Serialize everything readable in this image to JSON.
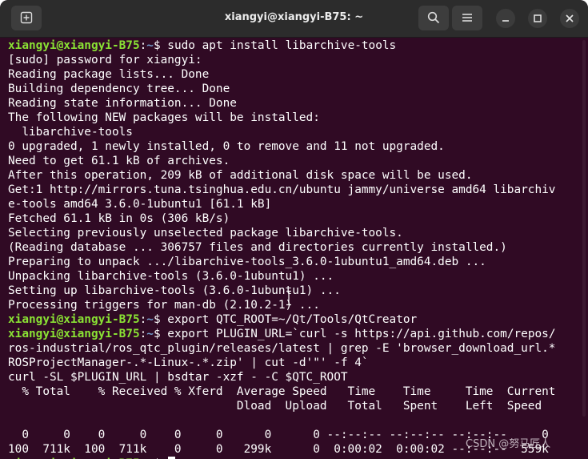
{
  "window": {
    "title": "xiangyi@xiangyi-B75: ~"
  },
  "toolbar": {
    "new_tab_icon": "new-tab-icon",
    "search_icon": "search-icon",
    "menu_icon": "hamburger-menu-icon",
    "minimize_icon": "minimize-icon",
    "maximize_icon": "maximize-icon",
    "close_icon": "close-icon"
  },
  "colors": {
    "terminal_bg": "#300a24",
    "prompt_user": "#8ae234",
    "prompt_path": "#729fcf",
    "text": "#ffffff"
  },
  "prompt": {
    "user_host": "xiangyi@xiangyi-B75",
    "colon": ":",
    "path": "~",
    "dollar": "$"
  },
  "terminal": {
    "lines": [
      {
        "type": "prompt",
        "cmd": " sudo apt install libarchive-tools"
      },
      {
        "type": "text",
        "text": "[sudo] password for xiangyi:"
      },
      {
        "type": "text",
        "text": "Reading package lists... Done"
      },
      {
        "type": "text",
        "text": "Building dependency tree... Done"
      },
      {
        "type": "text",
        "text": "Reading state information... Done"
      },
      {
        "type": "text",
        "text": "The following NEW packages will be installed:"
      },
      {
        "type": "text",
        "text": "  libarchive-tools"
      },
      {
        "type": "text",
        "text": "0 upgraded, 1 newly installed, 0 to remove and 11 not upgraded."
      },
      {
        "type": "text",
        "text": "Need to get 61.1 kB of archives."
      },
      {
        "type": "text",
        "text": "After this operation, 209 kB of additional disk space will be used."
      },
      {
        "type": "text",
        "text": "Get:1 http://mirrors.tuna.tsinghua.edu.cn/ubuntu jammy/universe amd64 libarchiv"
      },
      {
        "type": "text",
        "text": "e-tools amd64 3.6.0-1ubuntu1 [61.1 kB]"
      },
      {
        "type": "text",
        "text": "Fetched 61.1 kB in 0s (306 kB/s)"
      },
      {
        "type": "text",
        "text": "Selecting previously unselected package libarchive-tools."
      },
      {
        "type": "text",
        "text": "(Reading database ... 306757 files and directories currently installed.)"
      },
      {
        "type": "text",
        "text": "Preparing to unpack .../libarchive-tools_3.6.0-1ubuntu1_amd64.deb ..."
      },
      {
        "type": "text",
        "text": "Unpacking libarchive-tools (3.6.0-1ubuntu1) ..."
      },
      {
        "type": "text",
        "text": "Setting up libarchive-tools (3.6.0-1ubuntu1) ..."
      },
      {
        "type": "text",
        "text": "Processing triggers for man-db (2.10.2-1) ..."
      },
      {
        "type": "prompt",
        "cmd": " export QTC_ROOT=~/Qt/Tools/QtCreator"
      },
      {
        "type": "prompt",
        "cmd": " export PLUGIN_URL=`curl -s https://api.github.com/repos/"
      },
      {
        "type": "text",
        "text": "ros-industrial/ros_qtc_plugin/releases/latest | grep -E 'browser_download_url.*"
      },
      {
        "type": "text",
        "text": "ROSProjectManager-.*-Linux-.*.zip' | cut -d'\"' -f 4`"
      },
      {
        "type": "text",
        "text": "curl -SL $PLUGIN_URL | bsdtar -xzf - -C $QTC_ROOT"
      },
      {
        "type": "text",
        "text": "  % Total    % Received % Xferd  Average Speed   Time    Time     Time  Current"
      },
      {
        "type": "text",
        "text": "                                 Dload  Upload   Total   Spent    Left  Speed"
      },
      {
        "type": "text",
        "text": ""
      },
      {
        "type": "text",
        "text": "  0     0    0     0    0     0      0      0 --:--:-- --:--:-- --:--:--     0"
      },
      {
        "type": "text",
        "text": "100  711k  100  711k    0     0   299k      0  0:00:02  0:00:02 --:--:--  559k"
      },
      {
        "type": "prompt",
        "cmd": " ",
        "cursor": true
      }
    ]
  },
  "watermark": "CSDN @努马匠人"
}
